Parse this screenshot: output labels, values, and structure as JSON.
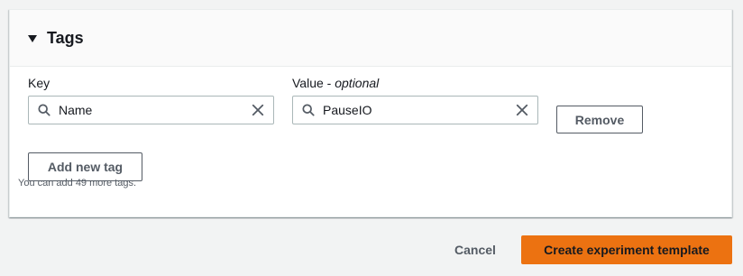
{
  "tags_panel": {
    "title": "Tags",
    "key_label": "Key",
    "value_label": "Value",
    "value_label_suffix": "optional",
    "key_value": "Name",
    "value_value": "PauseIO",
    "remove_label": "Remove",
    "add_label": "Add new tag",
    "hint": "You can add 49 more tags."
  },
  "footer": {
    "cancel_label": "Cancel",
    "create_label": "Create experiment template"
  },
  "colors": {
    "primary": "#ec7211",
    "text": "#16191f",
    "secondary_text": "#545b64",
    "border": "#aab7b8"
  },
  "icons": [
    "caret-down-icon",
    "search-icon",
    "clear-icon"
  ]
}
